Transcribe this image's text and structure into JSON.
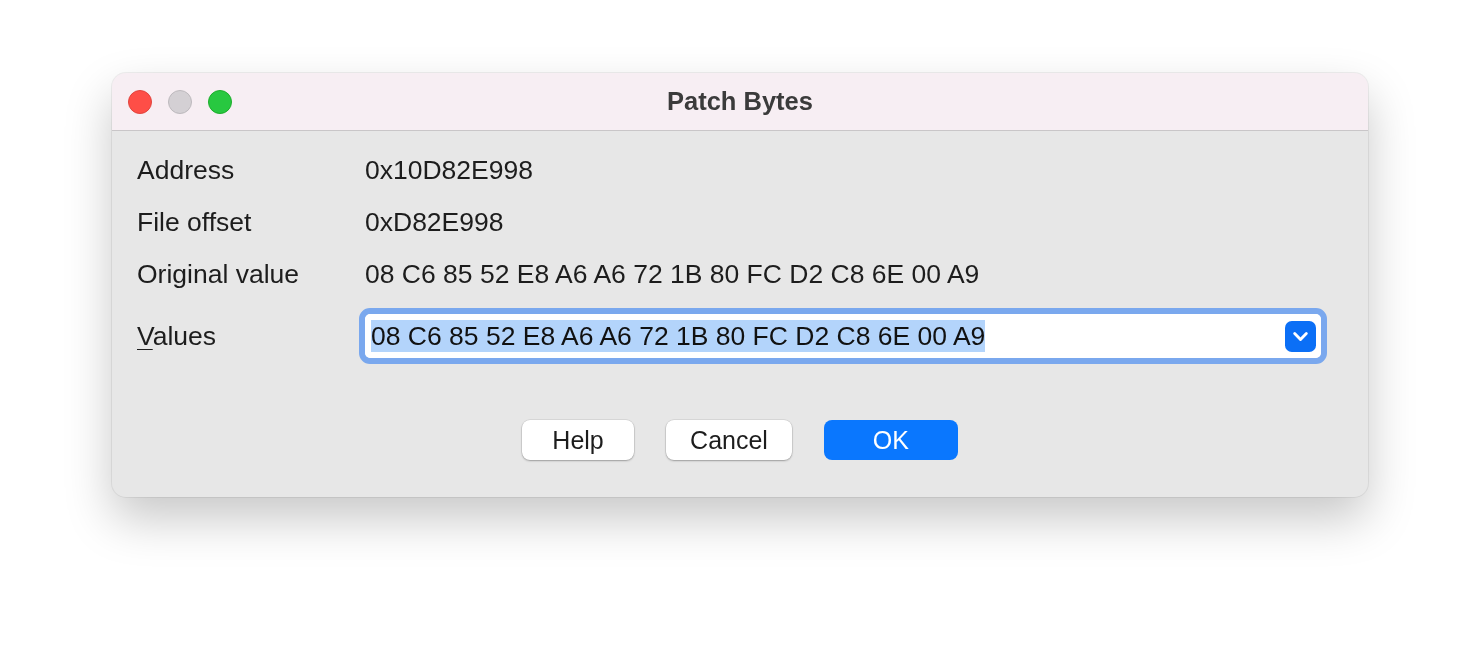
{
  "window": {
    "title": "Patch Bytes",
    "controls": [
      {
        "kind": "close",
        "disabled": false
      },
      {
        "kind": "minimize",
        "disabled": true
      },
      {
        "kind": "zoom",
        "disabled": false
      }
    ]
  },
  "fields": [
    {
      "label": "Address",
      "value": "0x10D82E998"
    },
    {
      "label": "File offset",
      "value": "0xD82E998"
    },
    {
      "label": "Original value",
      "value": "08 C6 85 52 E8 A6 A6 72 1B 80 FC D2 C8 6E 00 A9"
    }
  ],
  "values_input": {
    "label": "Values",
    "mnemonic_underlined": true,
    "value": "08 C6 85 52 E8 A6 A6 72 1B 80 FC D2 C8 6E 00 A9",
    "focused": true,
    "text_selected": true
  },
  "buttons": [
    {
      "label": "Help",
      "default": false
    },
    {
      "label": "Cancel",
      "default": false
    },
    {
      "label": "OK",
      "default": true
    }
  ]
}
